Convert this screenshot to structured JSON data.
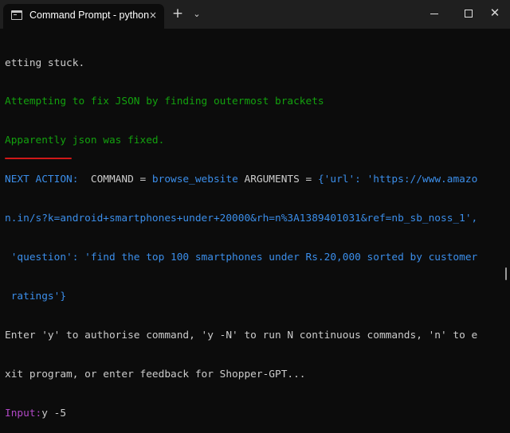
{
  "window": {
    "tab_title": "Command Prompt - python",
    "tab_close_glyph": "×",
    "new_tab_glyph": "+",
    "dropdown_glyph": "⌄",
    "close_glyph": "✕"
  },
  "colors": {
    "background": "#0c0c0c",
    "text": "#cccccc",
    "green": "#13a10e",
    "blue": "#3b8eea",
    "magenta": "#b148c6",
    "annotation_underline": "#d01818"
  },
  "terminal": {
    "l1": "etting stuck.",
    "l2": "Attempting to fix JSON by finding outermost brackets",
    "l3": "Apparently json was fixed.",
    "l4_label": "NEXT ACTION:",
    "l4_cmd_label": "  COMMAND = ",
    "l4_cmd": "browse_website",
    "l4_args_label": " ARGUMENTS = ",
    "l4_args": "{'url': 'https://www.amazo",
    "l5": "n.in/s?k=android+smartphones+under+20000&rh=n%3A1389401031&ref=nb_sb_noss_1',",
    "l6": " 'question': 'find the top 100 smartphones under Rs.20,000 sorted by customer",
    "l7": " ratings'}",
    "l8": "Enter 'y' to authorise command, 'y -N' to run N continuous commands, 'n' to e",
    "l9": "xit program, or enter feedback for Shopper-GPT...",
    "l10_prompt": "Input:",
    "l10_value": "y -5"
  }
}
